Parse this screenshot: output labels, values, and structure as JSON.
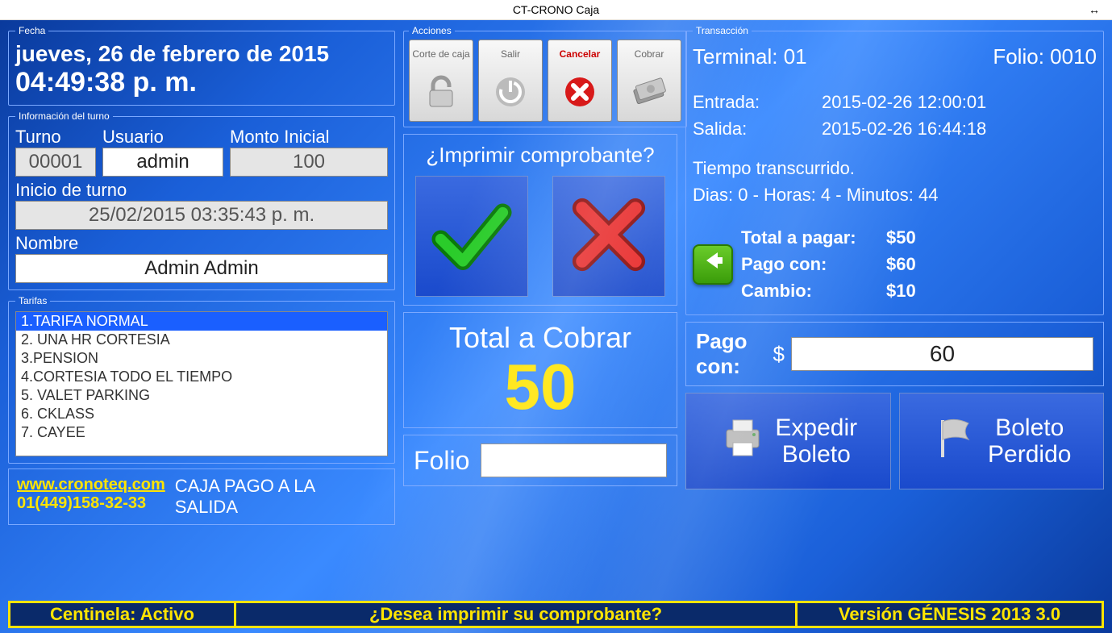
{
  "window": {
    "title": "CT-CRONO Caja"
  },
  "fecha": {
    "legend": "Fecha",
    "date": "jueves, 26 de febrero de 2015",
    "time": "04:49:38 p. m."
  },
  "turno": {
    "legend": "Información del turno",
    "turno_label": "Turno",
    "usuario_label": "Usuario",
    "monto_label": "Monto Inicial",
    "turno_val": "00001",
    "usuario_val": "admin",
    "monto_val": "100",
    "inicio_label": "Inicio de turno",
    "inicio_val": "25/02/2015 03:35:43 p. m.",
    "nombre_label": "Nombre",
    "nombre_val": "Admin Admin"
  },
  "acciones": {
    "legend": "Acciones",
    "corte": "Corte de caja",
    "salir": "Salir",
    "cancelar": "Cancelar",
    "cobrar": "Cobrar"
  },
  "confirm": {
    "title": "¿Imprimir comprobante?"
  },
  "total": {
    "title": "Total a Cobrar",
    "value": "50"
  },
  "folio": {
    "label": "Folio",
    "value": ""
  },
  "tarifas": {
    "legend": "Tarifas",
    "items": [
      "1.TARIFA NORMAL",
      "2. UNA HR CORTESIA",
      "3.PENSION",
      "4.CORTESIA TODO EL TIEMPO",
      "5. VALET PARKING",
      "6. CKLASS",
      "7. CAYEE"
    ],
    "selected": 0
  },
  "contact": {
    "url": "www.cronoteq.com",
    "tel": "01(449)158-32-33",
    "mode": "CAJA PAGO A LA SALIDA"
  },
  "trans": {
    "legend": "Transacción",
    "terminal_label": "Terminal:",
    "terminal_val": "01",
    "folio_label": "Folio:",
    "folio_val": "0010",
    "entrada_label": "Entrada:",
    "entrada_val": "2015-02-26 12:00:01",
    "salida_label": "Salida:",
    "salida_val": "2015-02-26 16:44:18",
    "tiempo_label": "Tiempo transcurrido.",
    "tiempo_val": "Dias: 0 - Horas: 4 - Minutos: 44",
    "totalpagar_label": "Total a pagar:",
    "totalpagar_val": "$50",
    "pagocon_label": "Pago con:",
    "pagocon_val": "$60",
    "cambio_label": "Cambio:",
    "cambio_val": "$10"
  },
  "pago": {
    "label": "Pago con:",
    "currency": "$",
    "value": "60"
  },
  "bigactions": {
    "expedir": "Expedir Boleto",
    "perdido": "Boleto Perdido"
  },
  "status": {
    "left": "Centinela: Activo",
    "center": "¿Desea imprimir su comprobante?",
    "right": "Versión GÉNESIS 2013 3.0"
  }
}
